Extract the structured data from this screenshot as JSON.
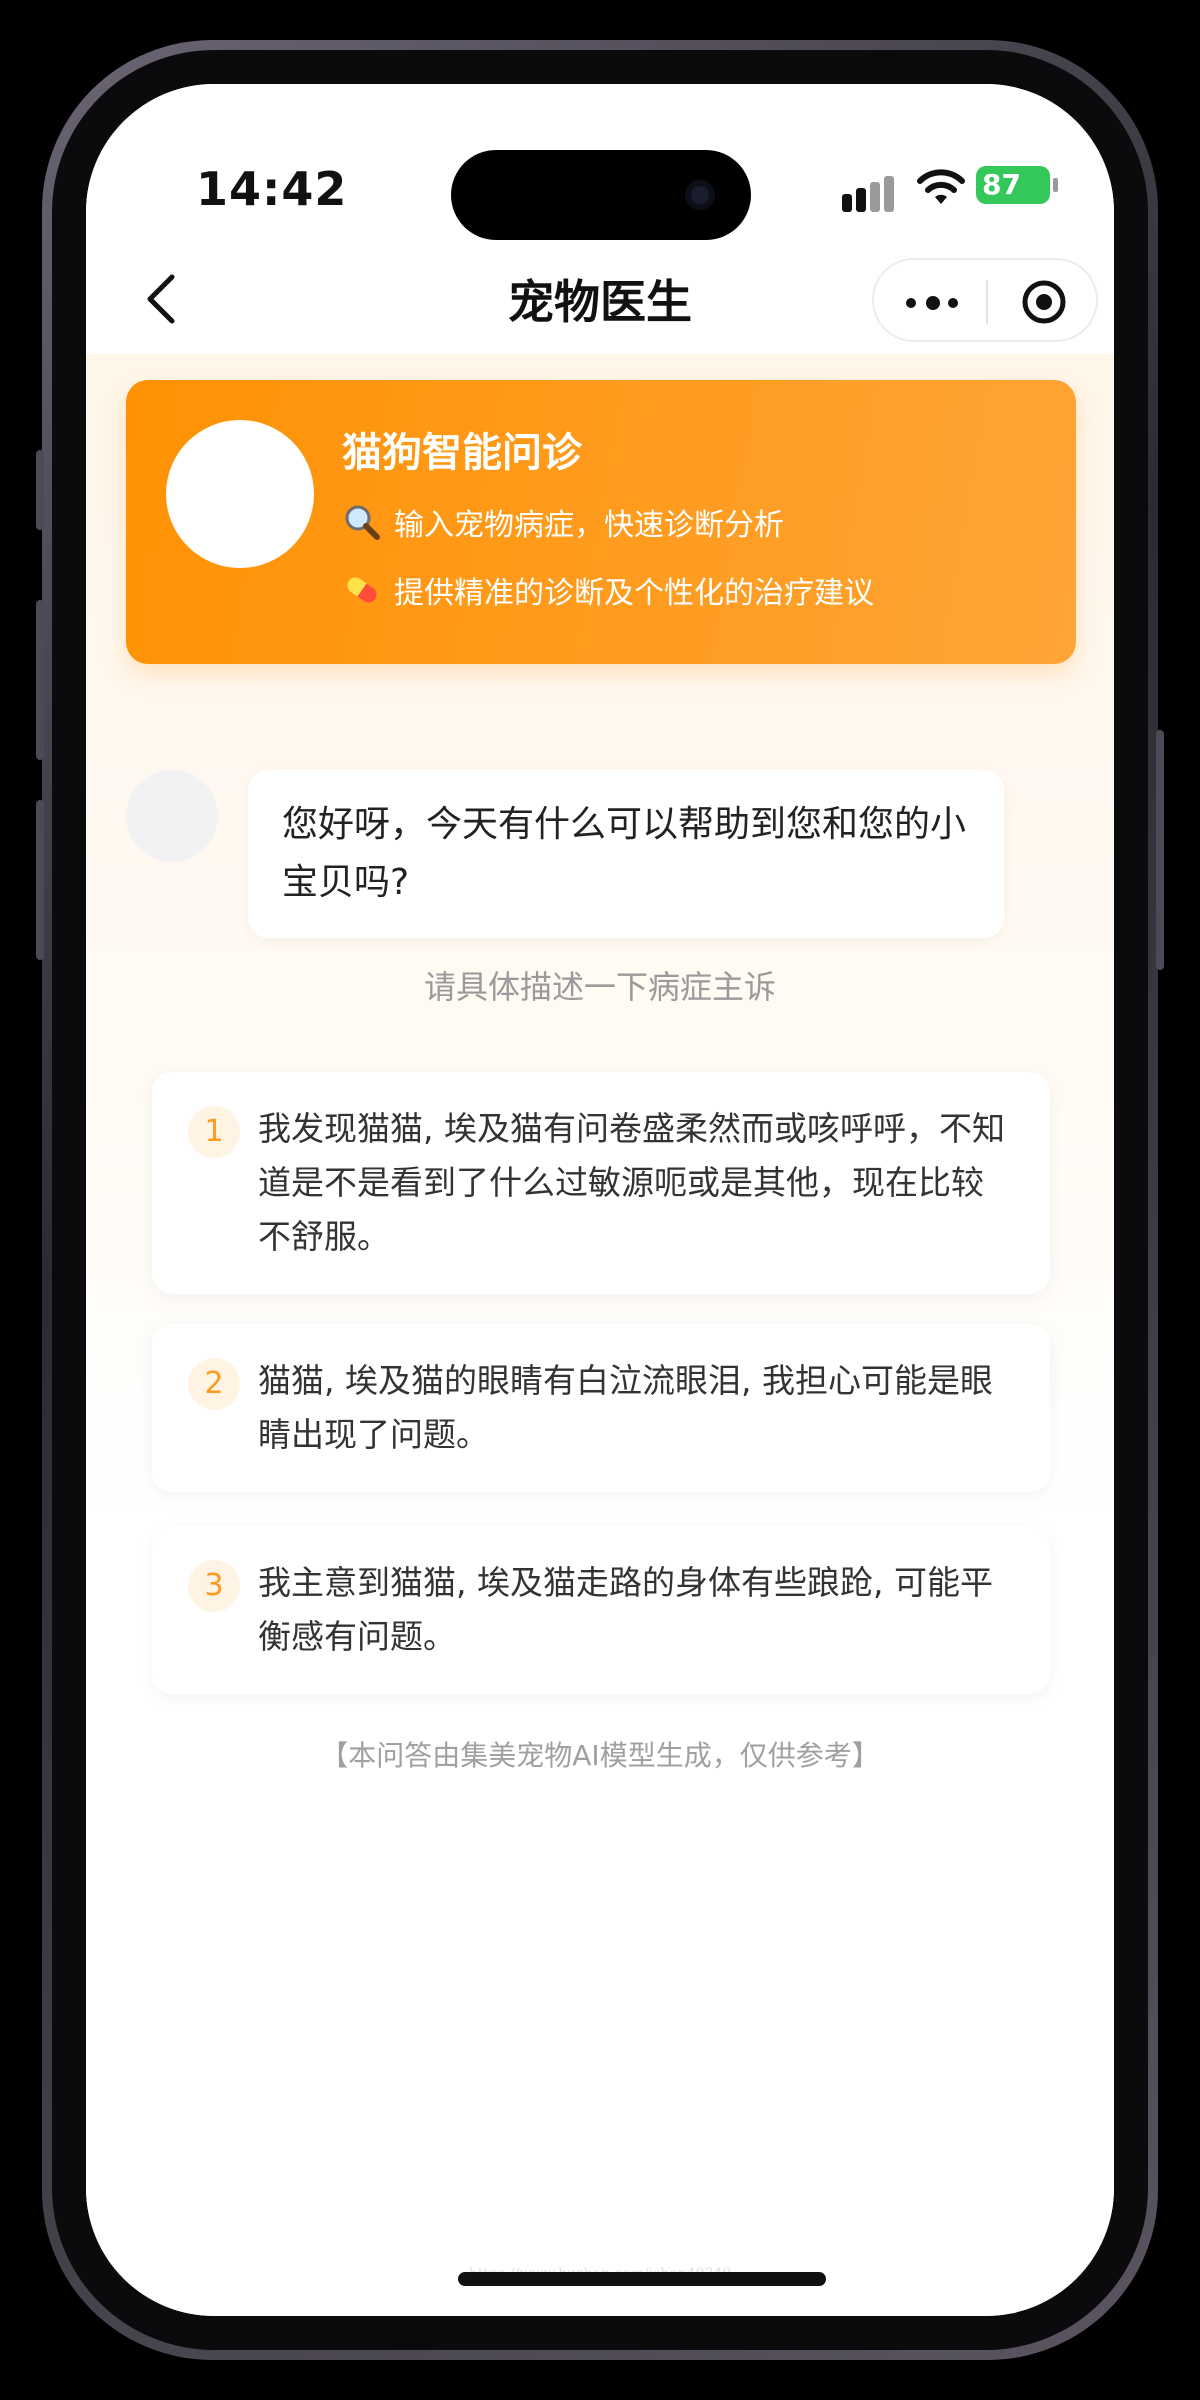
{
  "status_bar": {
    "time": "14:42",
    "battery": "87"
  },
  "nav": {
    "title": "宠物医生"
  },
  "banner": {
    "title": "猫狗智能问诊",
    "line1": "输入宠物病症，快速诊断分析",
    "line2": "提供精准的诊断及个性化的治疗建议",
    "line1_icon": "magnifier-icon",
    "line2_icon": "pill-icon"
  },
  "chat": {
    "greeting": "您好呀，今天有什么可以帮助到您和您的小宝贝吗?",
    "hint": "请具体描述一下病症主诉"
  },
  "questions": [
    {
      "num": "1",
      "text": "我发现猫猫, 埃及猫有问卷盛柔然而或咳呼呼，不知道是不是看到了什么过敏源呃或是其他，现在比较不舒服。"
    },
    {
      "num": "2",
      "text": "猫猫, 埃及猫的眼睛有白泣流眼泪, 我担心可能是眼睛出现了问题。"
    },
    {
      "num": "3",
      "text": "我主意到猫猫, 埃及猫走路的身体有些踉跄, 可能平衡感有问题。"
    }
  ],
  "disclaimer": "【本问答由集美宠物AI模型生成，仅供参考】",
  "watermark": "https://www.huzhan.com/ishop40340",
  "colors": {
    "accent": "#ff9204",
    "accent_light": "#ffa436",
    "battery": "#34c759"
  }
}
